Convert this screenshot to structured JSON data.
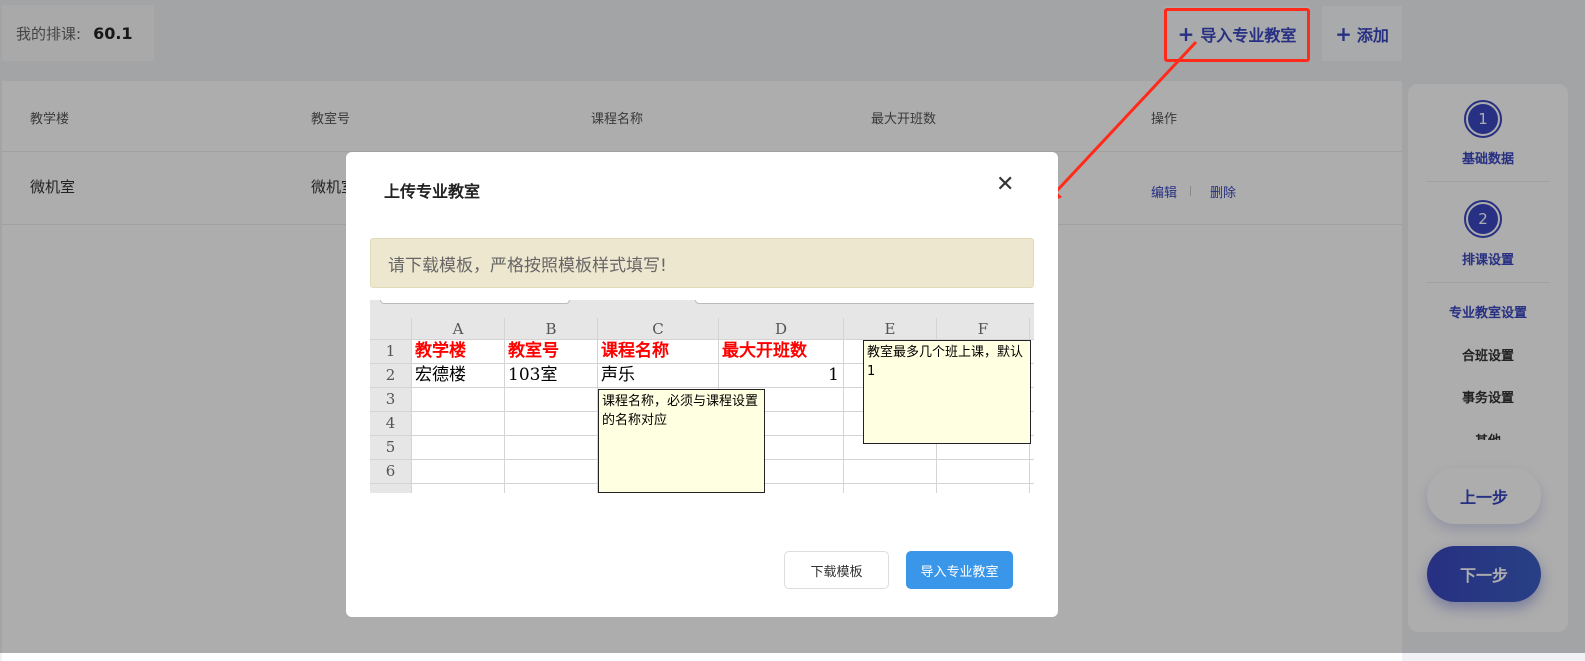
{
  "header": {
    "stat_label": "我的排课:",
    "stat_value": "60.1",
    "import_button": "导入专业教室",
    "add_button": "添加",
    "plus_icon": "plus-icon"
  },
  "table": {
    "columns": [
      "教学楼",
      "教室号",
      "课程名称",
      "最大开班数",
      "操作"
    ],
    "rows": [
      {
        "building": "微机室",
        "room": "微机室",
        "actions": [
          "编辑",
          "删除"
        ]
      }
    ]
  },
  "sidebar": {
    "steps": [
      {
        "num": "1",
        "label": "基础数据"
      },
      {
        "num": "2",
        "label": "排课设置"
      }
    ],
    "items": [
      "专业教室设置",
      "合班设置",
      "事务设置",
      "其他"
    ],
    "prev": "上一步",
    "next": "下一步"
  },
  "modal": {
    "title": "上传专业教室",
    "alert": "请下载模板，严格按照模板样式填写!",
    "download_button": "下载模板",
    "import_button": "导入专业教室",
    "sheet": {
      "cols": [
        "A",
        "B",
        "C",
        "D",
        "E",
        "F"
      ],
      "rows": [
        "1",
        "2",
        "3",
        "4",
        "5",
        "6"
      ],
      "headers": [
        "教学楼",
        "教室号",
        "课程名称",
        "最大开班数"
      ],
      "row2": [
        "宏德楼",
        "103室",
        "声乐",
        "1"
      ],
      "note_c": "课程名称，必须与课程设置的名称对应",
      "note_e": "教室最多几个班上课，默认1"
    }
  },
  "colors": {
    "accent": "#3a47c0",
    "primary": "#3a96e8",
    "annotation": "#ff2a1a"
  }
}
